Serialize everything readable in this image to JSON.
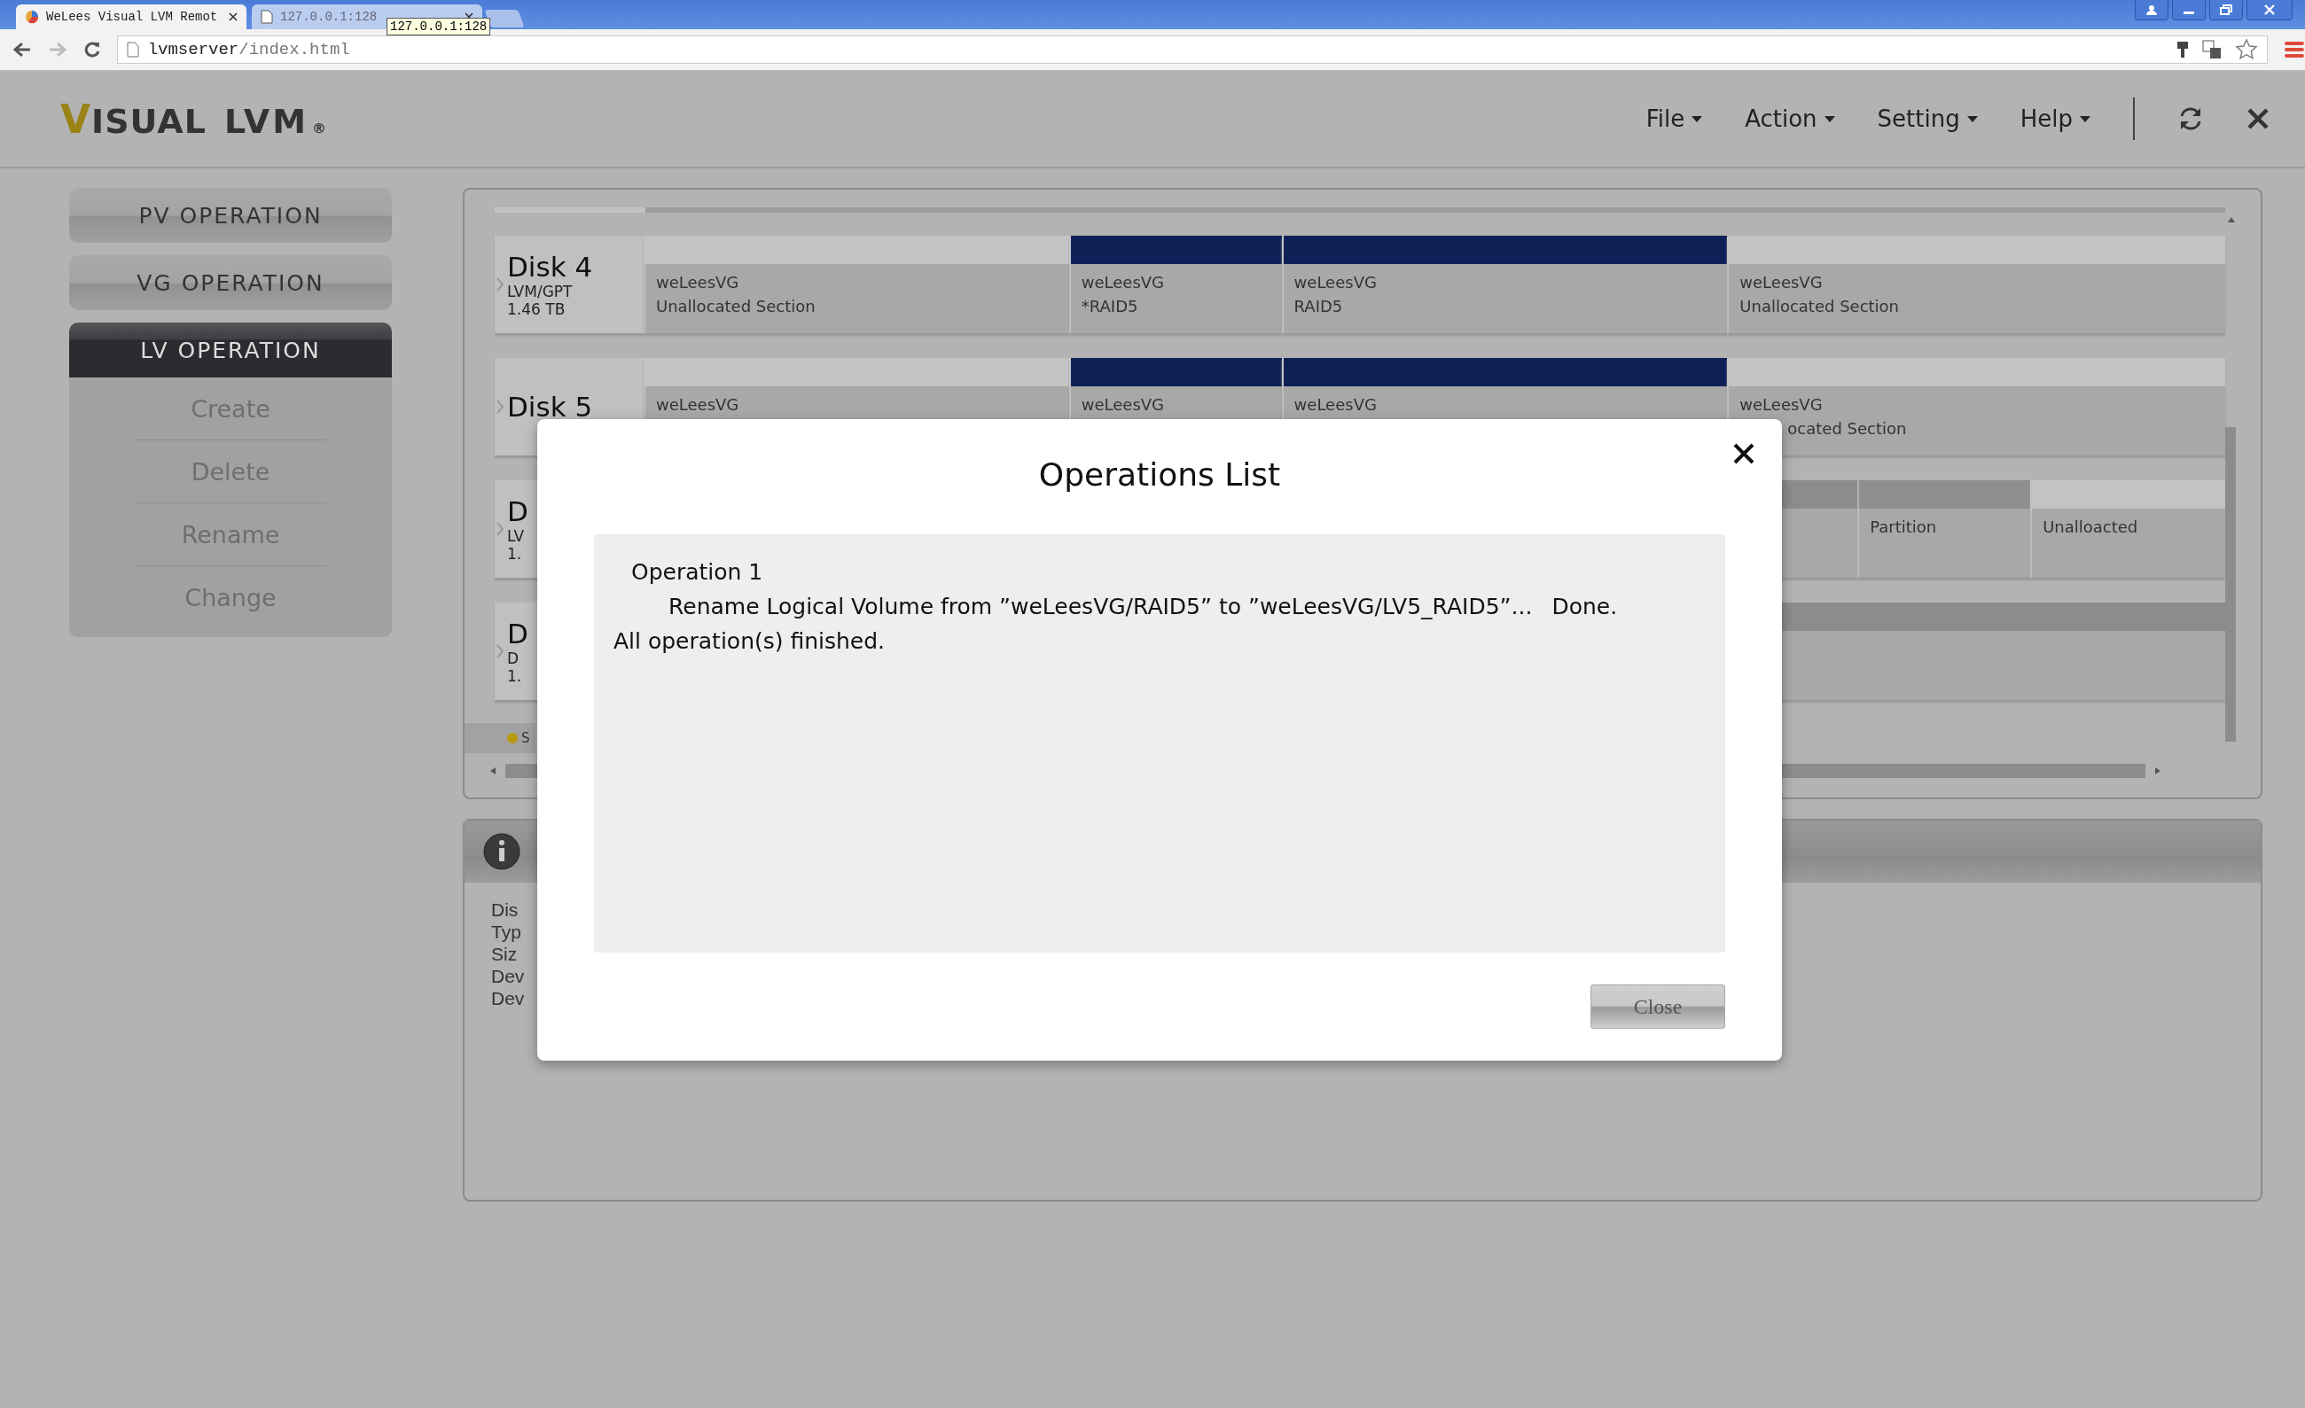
{
  "browser": {
    "tabs": [
      {
        "title": "WeLees Visual LVM Remot",
        "selected": true
      },
      {
        "title": "127.0.0.1:128",
        "selected": false
      }
    ],
    "tooltip": "127.0.0.1:128",
    "url_host": "lvmserver",
    "url_path": "/index.html"
  },
  "logo": {
    "initial": "V",
    "rest": "ISUAL",
    "product": "LVM",
    "mark": "®"
  },
  "menus": [
    "File",
    "Action",
    "Setting",
    "Help"
  ],
  "sidebar": [
    {
      "label": "PV OPERATION",
      "selected": false
    },
    {
      "label": "VG OPERATION",
      "selected": false
    },
    {
      "label": "LV OPERATION",
      "selected": true,
      "items": [
        "Create",
        "Delete",
        "Rename",
        "Change"
      ]
    }
  ],
  "disks": [
    {
      "name": "Disk 4",
      "type": "LVM/GPT",
      "size": "1.46 TB",
      "segments": [
        {
          "kind": "free",
          "vg": "weLeesVG",
          "label": "Unallocated Section"
        },
        {
          "kind": "lv",
          "vg": "weLeesVG",
          "label": "*RAID5"
        },
        {
          "kind": "lv",
          "vg": "weLeesVG",
          "label": "RAID5"
        },
        {
          "kind": "free",
          "vg": "weLeesVG",
          "label": "Unallocated Section"
        }
      ]
    },
    {
      "name": "Disk 5",
      "segments": [
        {
          "kind": "free",
          "vg": "weLeesVG"
        },
        {
          "kind": "lv",
          "vg": "weLeesVG"
        },
        {
          "kind": "lv",
          "vg": "weLeesVG"
        },
        {
          "kind": "free",
          "vg": "weLeesVG",
          "label": "ocated Section",
          "cut": true
        }
      ]
    },
    {
      "name": "D",
      "type": "LV",
      "size": "1.",
      "segments": [
        {
          "kind": "other"
        },
        {
          "kind": "partition",
          "label": "Partition"
        },
        {
          "kind": "free",
          "label": "Unalloacted"
        }
      ]
    },
    {
      "name": "D",
      "type": "D",
      "size": "1.",
      "segments": [
        {
          "kind": "other"
        }
      ]
    }
  ],
  "legend": "S",
  "info": {
    "labels": [
      "Dis",
      "Typ",
      "Siz",
      "Dev",
      "Dev"
    ]
  },
  "dialog": {
    "title": "Operations List",
    "operations": [
      {
        "title": "Operation 1",
        "detail": "Rename Logical Volume from ”weLeesVG/RAID5” to ”weLeesVG/LV5_RAID5”...",
        "status": "Done."
      }
    ],
    "summary": "All operation(s) finished.",
    "button": "Close"
  }
}
